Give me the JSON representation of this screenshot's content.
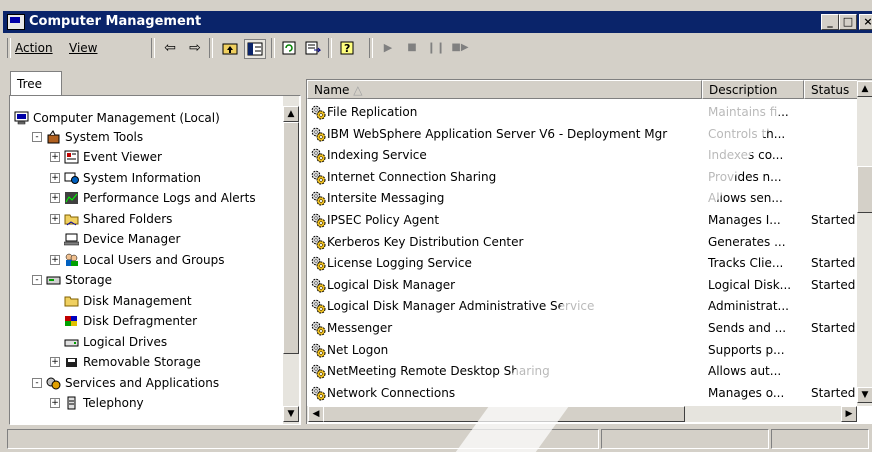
{
  "window": {
    "title": "Computer Management"
  },
  "menu": {
    "action": "Action",
    "view": "View"
  },
  "toolbar": {
    "icons": [
      "back-arrow-icon",
      "forward-arrow-icon",
      "up-one-level-icon",
      "show-hide-tree-icon",
      "refresh-icon",
      "export-list-icon",
      "help-icon",
      "play-icon",
      "stop-icon",
      "pause-icon",
      "restart-icon"
    ]
  },
  "tree": {
    "tab": "Tree",
    "items": [
      {
        "label": "Computer Management (Local)",
        "level": 0,
        "expander": "",
        "icon": "computer-icon"
      },
      {
        "label": "System Tools",
        "level": 1,
        "expander": "-",
        "icon": "tools-icon"
      },
      {
        "label": "Event Viewer",
        "level": 2,
        "expander": "+",
        "icon": "event-viewer-icon"
      },
      {
        "label": "System Information",
        "level": 2,
        "expander": "+",
        "icon": "system-info-icon"
      },
      {
        "label": "Performance Logs and Alerts",
        "level": 2,
        "expander": "+",
        "icon": "performance-icon"
      },
      {
        "label": "Shared Folders",
        "level": 2,
        "expander": "+",
        "icon": "shared-folders-icon"
      },
      {
        "label": "Device Manager",
        "level": 2,
        "expander": "",
        "icon": "device-manager-icon"
      },
      {
        "label": "Local Users and Groups",
        "level": 2,
        "expander": "+",
        "icon": "users-icon"
      },
      {
        "label": "Storage",
        "level": 1,
        "expander": "-",
        "icon": "storage-icon"
      },
      {
        "label": "Disk Management",
        "level": 2,
        "expander": "",
        "icon": "disk-management-icon"
      },
      {
        "label": "Disk Defragmenter",
        "level": 2,
        "expander": "",
        "icon": "defragmenter-icon"
      },
      {
        "label": "Logical Drives",
        "level": 2,
        "expander": "",
        "icon": "logical-drives-icon"
      },
      {
        "label": "Removable Storage",
        "level": 2,
        "expander": "+",
        "icon": "removable-storage-icon"
      },
      {
        "label": "Services and Applications",
        "level": 1,
        "expander": "-",
        "icon": "services-apps-icon"
      },
      {
        "label": "Telephony",
        "level": 2,
        "expander": "+",
        "icon": "telephony-icon"
      }
    ]
  },
  "list": {
    "columns": {
      "name": "Name",
      "description": "Description",
      "status": "Status"
    },
    "rows": [
      {
        "name": "File Replication",
        "description": "Maintains fi...",
        "status": ""
      },
      {
        "name": "IBM WebSphere Application Server V6 - Deployment Mgr",
        "description": "Controls th...",
        "status": ""
      },
      {
        "name": "Indexing Service",
        "description": "Indexes co...",
        "status": ""
      },
      {
        "name": "Internet Connection Sharing",
        "description": "Provides n...",
        "status": ""
      },
      {
        "name": "Intersite Messaging",
        "description": "Allows sen...",
        "status": ""
      },
      {
        "name": "IPSEC Policy Agent",
        "description": "Manages I...",
        "status": "Started"
      },
      {
        "name": "Kerberos Key Distribution Center",
        "description": "Generates ...",
        "status": ""
      },
      {
        "name": "License Logging Service",
        "description": "Tracks Clie...",
        "status": "Started"
      },
      {
        "name": "Logical Disk Manager",
        "description": "Logical Disk...",
        "status": "Started"
      },
      {
        "name": "Logical Disk Manager Administrative Service",
        "description": "Administrat...",
        "status": ""
      },
      {
        "name": "Messenger",
        "description": "Sends and ...",
        "status": "Started"
      },
      {
        "name": "Net Logon",
        "description": "Supports p...",
        "status": ""
      },
      {
        "name": "NetMeeting Remote Desktop Sharing",
        "description": "Allows aut...",
        "status": ""
      },
      {
        "name": "Network Connections",
        "description": "Manages o...",
        "status": "Started"
      }
    ]
  }
}
